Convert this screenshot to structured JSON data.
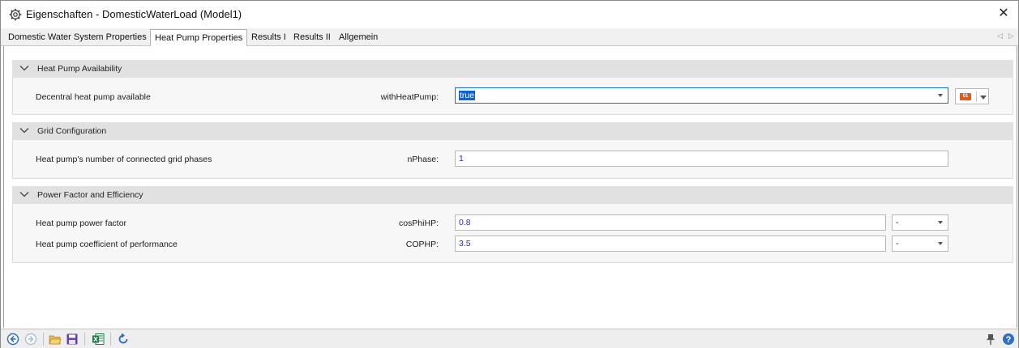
{
  "window": {
    "title": "Eigenschaften - DomesticWaterLoad (Model1)",
    "title_icon": "gear-icon",
    "close_label": "✕"
  },
  "tabs": [
    {
      "label": "Domestic Water System Properties",
      "active": false
    },
    {
      "label": "Heat Pump Properties",
      "active": true
    },
    {
      "label": "Results I",
      "active": false
    },
    {
      "label": "Results II",
      "active": false
    },
    {
      "label": "Allgemein",
      "active": false
    }
  ],
  "tab_scroll": {
    "left": "◁",
    "right": "▷"
  },
  "sections": [
    {
      "title": "Heat Pump Availability",
      "rows": [
        {
          "label": "Decentral heat pump available",
          "param": "withHeatPump:",
          "value": "true",
          "type": "dropdown",
          "selected": true
        }
      ]
    },
    {
      "title": "Grid Configuration",
      "rows": [
        {
          "label": "Heat pump's number of connected grid phases",
          "param": "nPhase:",
          "value": "1",
          "type": "text"
        }
      ]
    },
    {
      "title": "Power Factor and Efficiency",
      "rows": [
        {
          "label": "Heat pump power factor",
          "param": "cosPhiHP:",
          "value": "0.8",
          "unit": "-",
          "type": "text"
        },
        {
          "label": "Heat pump coefficient of performance",
          "param": "COPHP:",
          "value": "3.5",
          "unit": "-",
          "type": "text"
        }
      ]
    }
  ],
  "binary_button": {
    "icon": "binary-icon",
    "icon_text": "01"
  },
  "toolbar": {
    "icons": [
      "back-icon",
      "forward-icon",
      "open-folder-icon",
      "save-icon",
      "excel-icon",
      "refresh-icon"
    ],
    "right_icons": [
      "pin-icon",
      "help-icon"
    ]
  },
  "colors": {
    "accent": "#1a6fc9",
    "value_text": "#2a2ad8",
    "section_bg": "#e1e1e1"
  }
}
